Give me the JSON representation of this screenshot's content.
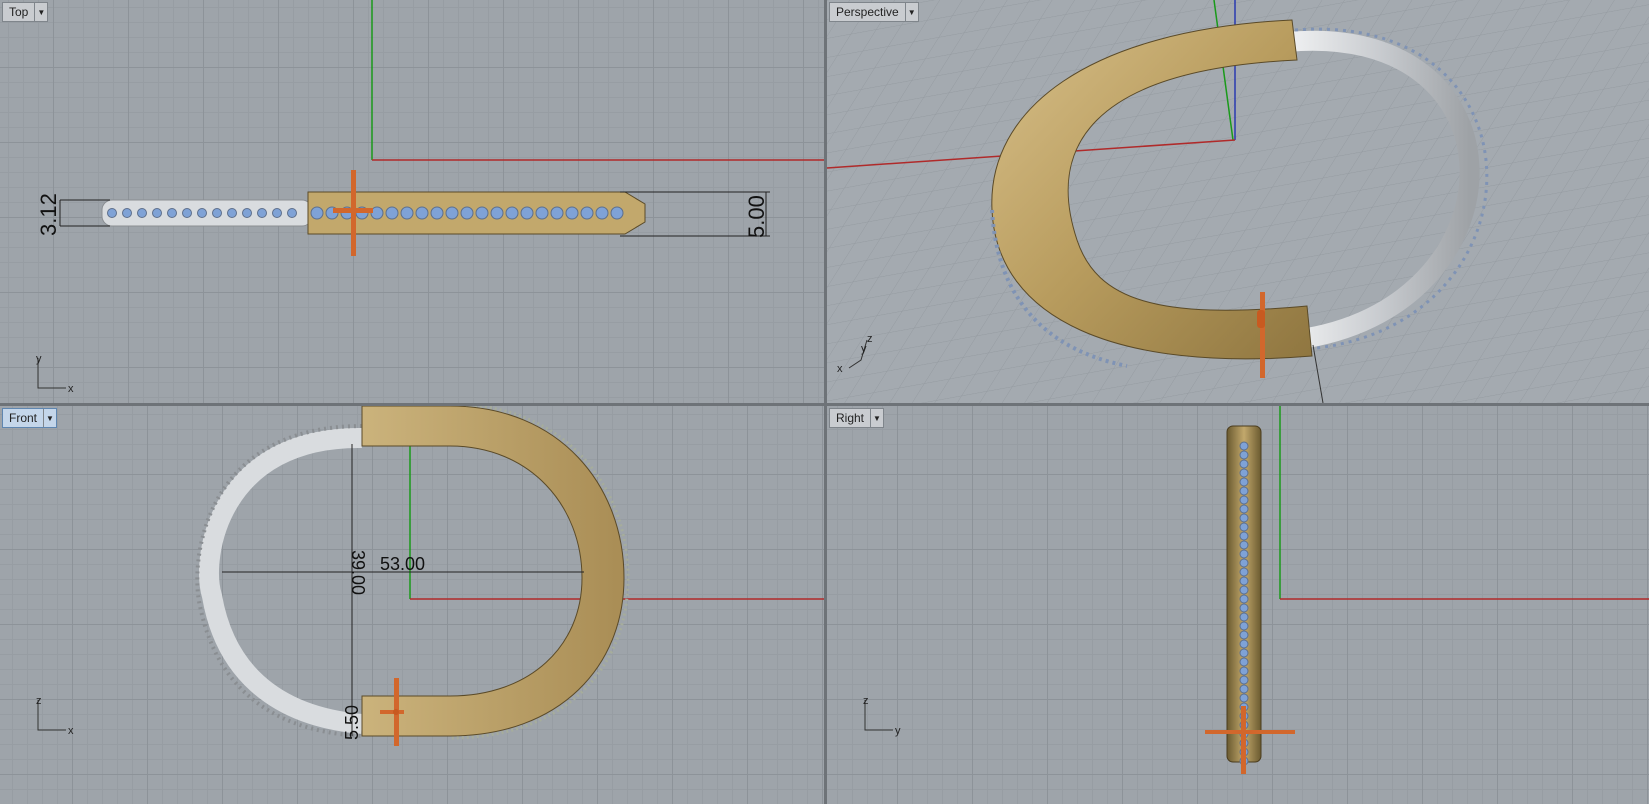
{
  "viewports": {
    "top": {
      "label": "Top",
      "axis_h": "x",
      "axis_v": "y"
    },
    "perspective": {
      "label": "Perspective",
      "axis_h": "x",
      "axis_v": "y",
      "axis_z": "z"
    },
    "front": {
      "label": "Front",
      "axis_h": "x",
      "axis_v": "z"
    },
    "right": {
      "label": "Right",
      "axis_h": "y",
      "axis_v": "z"
    }
  },
  "dimensions": {
    "top_left": "3.12",
    "top_right": "5.00",
    "front_height": "39.00",
    "front_width": "53.00",
    "front_small": "5.50"
  },
  "colors": {
    "grid_bg": "#9ea4aa",
    "gold": "#c2a86c",
    "silver": "#d9dcdf",
    "gem": "#7fa2d6",
    "x_axis": "#b02a2a",
    "y_axis": "#1a9a1a",
    "z_axis": "#2a3ab0",
    "marker": "#d2672c",
    "active_tab": "#c4d6ea"
  }
}
